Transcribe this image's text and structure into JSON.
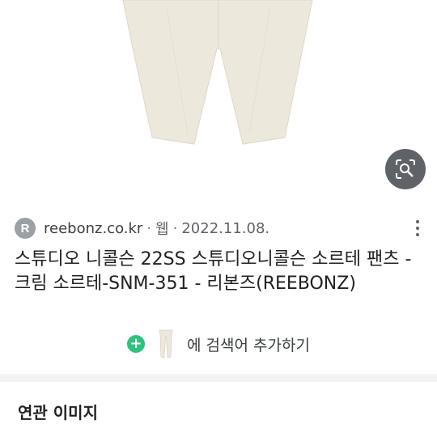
{
  "lens_button": {
    "icon": "lens-search-icon"
  },
  "source": {
    "favicon_letter": "R",
    "domain": "reebonz.co.kr",
    "type": "웹",
    "date": "2022.11.08."
  },
  "result": {
    "title": "스튜디오 니콜슨 22SS 스튜디오니콜슨 소르테 팬츠 - 크림 소르테-SNM-351 - 리본즈(REEBONZ)"
  },
  "add_to_search": {
    "label": "에 검색어 추가하기"
  },
  "related": {
    "heading": "연관 이미지"
  },
  "colors": {
    "accent_green": "#2ec27e",
    "pants_cream": "#ece8dc"
  }
}
